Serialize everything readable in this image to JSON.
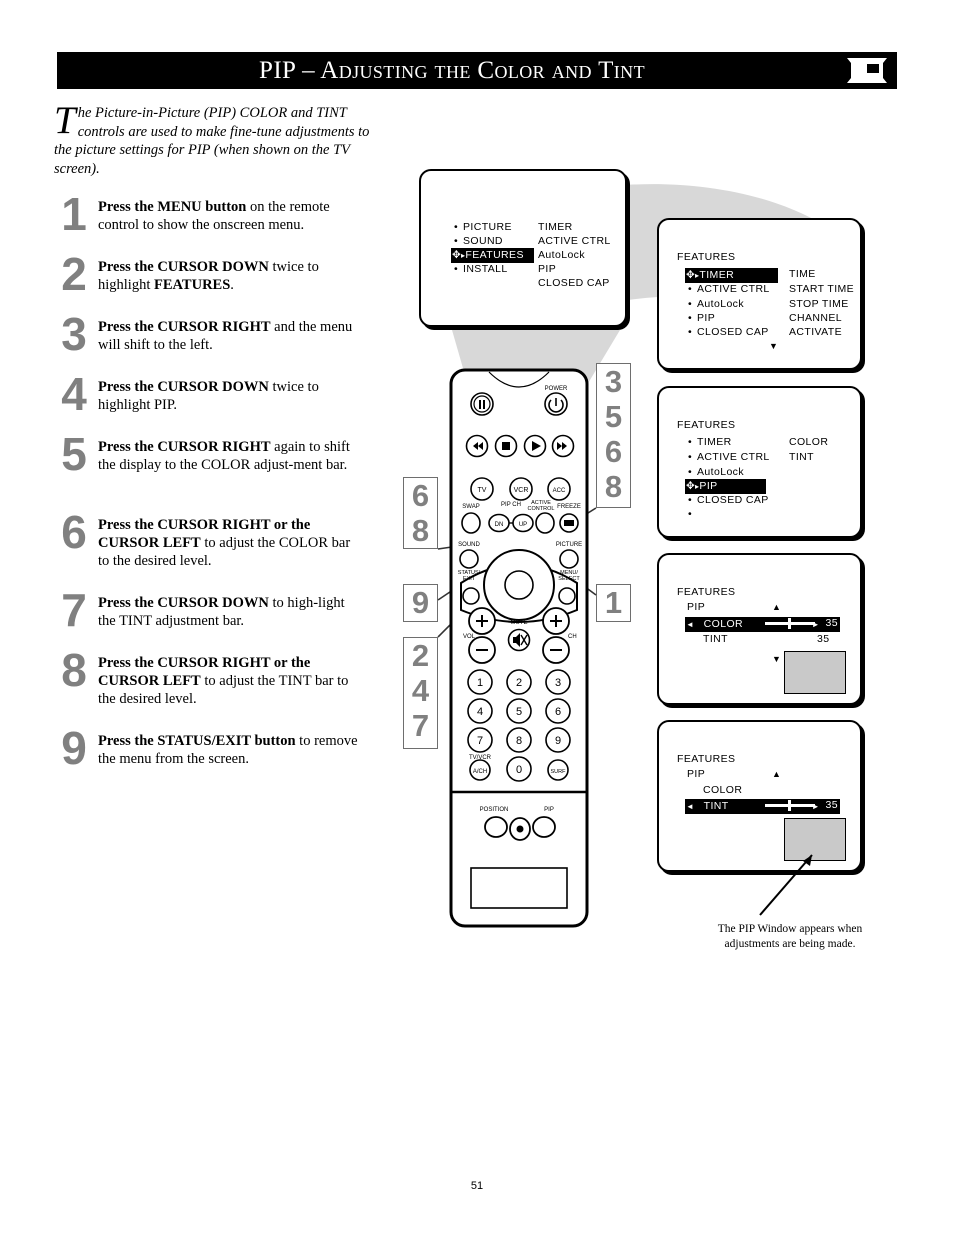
{
  "header": {
    "title": "PIP – Adjusting the Color and Tint",
    "icon": "tv-pip-icon"
  },
  "intro": {
    "dropcap": "T",
    "text": "he Picture-in-Picture (PIP) COLOR and TINT controls are used to make fine-tune adjustments to the picture settings for PIP (when shown on the TV screen)."
  },
  "steps": [
    {
      "num": "1",
      "bold": "Press the MENU button",
      "rest": " on the remote control to show the onscreen menu."
    },
    {
      "num": "2",
      "bold": "Press the CURSOR DOWN",
      "rest": " twice to highlight ",
      "bold2": "FEATURES",
      "rest2": "."
    },
    {
      "num": "3",
      "bold": "Press the CURSOR RIGHT",
      "rest": " and the menu will shift to the left."
    },
    {
      "num": "4",
      "bold": "Press the CURSOR DOWN",
      "rest": " twice to highlight PIP."
    },
    {
      "num": "5",
      "bold": "Press the CURSOR RIGHT",
      "rest": " again to shift the display to the COLOR adjust-ment bar."
    },
    {
      "num": "6",
      "bold": "Press the CURSOR RIGHT or the CURSOR LEFT",
      "rest": " to adjust the COLOR bar to the desired level."
    },
    {
      "num": "7",
      "bold": "Press the CURSOR DOWN",
      "rest": " to high-light the TINT adjustment bar."
    },
    {
      "num": "8",
      "bold": "Press the CURSOR RIGHT or the CURSOR LEFT",
      "rest": " to adjust the TINT bar to the desired level."
    },
    {
      "num": "9",
      "bold": "Press the STATUS/EXIT button",
      "rest": " to remove the menu from the screen."
    }
  ],
  "osd1": {
    "left_items": [
      "PICTURE",
      "SOUND",
      "FEATURES",
      "INSTALL"
    ],
    "highlighted": "FEATURES",
    "right_items": [
      "TIMER",
      "ACTIVE CTRL",
      "AutoLock",
      "PIP",
      "CLOSED CAP"
    ]
  },
  "osd2": {
    "title": "FEATURES",
    "left_items": [
      "TIMER",
      "ACTIVE CTRL",
      "AutoLock",
      "PIP",
      "CLOSED CAP"
    ],
    "highlighted": "TIMER",
    "right_items": [
      "TIME",
      "START TIME",
      "STOP TIME",
      "CHANNEL",
      "ACTIVATE"
    ],
    "scroll_down": "▼"
  },
  "osd3": {
    "title": "FEATURES",
    "left_items": [
      "TIMER",
      "ACTIVE CTRL",
      "AutoLock",
      "PIP",
      "CLOSED CAP",
      ""
    ],
    "highlighted": "PIP",
    "right_items": [
      "COLOR",
      "TINT"
    ]
  },
  "osd4": {
    "title": "FEATURES",
    "subtitle": "PIP",
    "rows": [
      {
        "label": "COLOR",
        "value": "35",
        "highlighted": true
      },
      {
        "label": "TINT",
        "value": "35",
        "highlighted": false
      }
    ],
    "scroll_up": "▲",
    "scroll_down": "▼",
    "left_arrow": "◄",
    "right_arrow": "►"
  },
  "osd5": {
    "title": "FEATURES",
    "subtitle": "PIP",
    "rows": [
      {
        "label": "COLOR",
        "value": "",
        "highlighted": false
      },
      {
        "label": "TINT",
        "value": "35",
        "highlighted": true
      }
    ],
    "scroll_up": "▲",
    "left_arrow": "◄",
    "right_arrow": "►"
  },
  "callouts": {
    "left_top": [
      "6",
      "8"
    ],
    "left_mid": [
      "9"
    ],
    "left_bottom": [
      "2",
      "4",
      "7"
    ],
    "right_top": [
      "3",
      "5",
      "6",
      "8"
    ],
    "right_bottom": [
      "1"
    ]
  },
  "remote": {
    "power_label": "POWER",
    "transport": [
      "rewind-icon",
      "stop-icon",
      "play-icon",
      "fast-forward-icon"
    ],
    "pause_label": "pause-icon",
    "source_buttons": [
      "TV",
      "VCR",
      "ACC"
    ],
    "swap_label": "SWAP",
    "pipch_label": "PIP CH",
    "pipch_dn": "DN",
    "pipch_up": "UP",
    "active_control_label": "ACTIVE CONTROL",
    "freeze_label": "FREEZE",
    "sound_label": "SOUND",
    "picture_label": "PICTURE",
    "status_exit_label": "STATUS/ EXIT",
    "menu_select_label": "MENU/ SELECT",
    "vol_label": "VOL",
    "ch_label": "CH",
    "mute_label": "MUTE",
    "plus": "+",
    "minus": "–",
    "keypad": [
      "1",
      "2",
      "3",
      "4",
      "5",
      "6",
      "7",
      "8",
      "9",
      "0"
    ],
    "tvvcr_label": "TV/VCR",
    "acn_label": "A/CH",
    "surf_label": "SURF",
    "position_label": "POSITION",
    "pip_label": "PIP"
  },
  "caption": "The PIP Window appears when adjustments are being made.",
  "page_number": "51",
  "colors": {
    "header_bg": "#000000",
    "step_number": "#808080",
    "beam": "#d8d8d8",
    "pip_window": "#c9c9c9"
  }
}
